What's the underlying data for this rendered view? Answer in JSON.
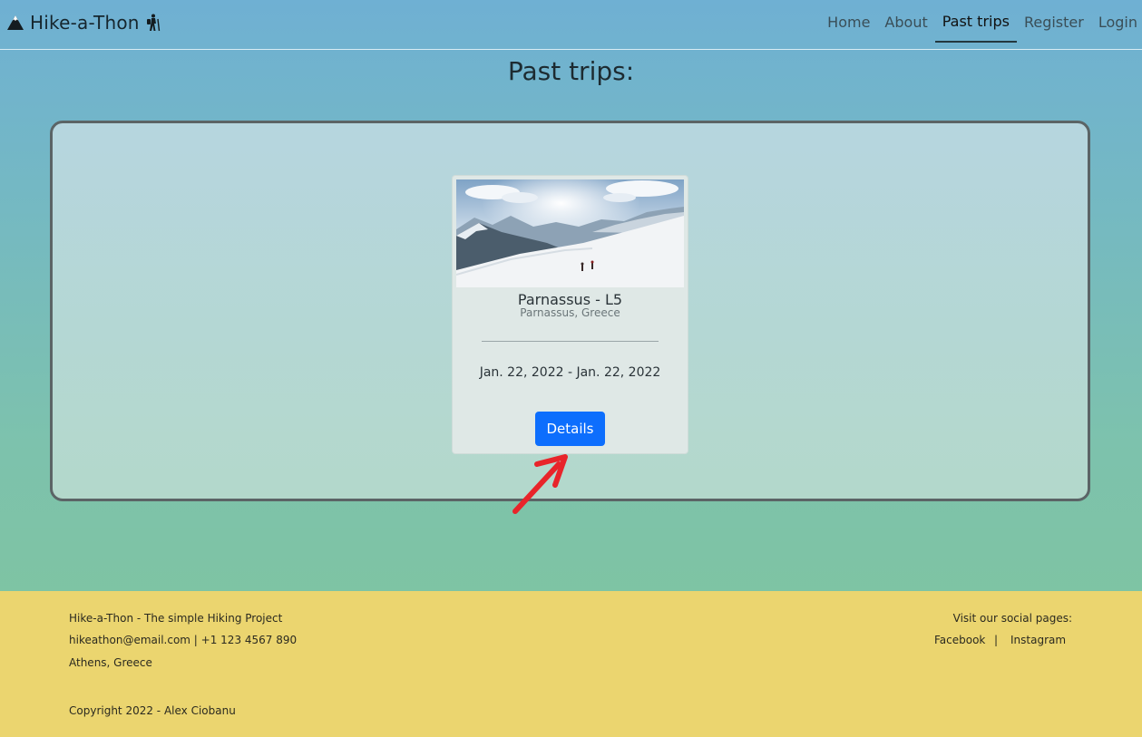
{
  "brand": {
    "name": "Hike-a-Thon"
  },
  "nav": {
    "items": [
      {
        "label": "Home"
      },
      {
        "label": "About"
      },
      {
        "label": "Past trips"
      },
      {
        "label": "Register"
      },
      {
        "label": "Login"
      }
    ],
    "active": "Past trips"
  },
  "page": {
    "title": "Past trips:"
  },
  "trip_card": {
    "title": "Parnassus - L5",
    "location": "Parnassus, Greece",
    "dates": "Jan. 22, 2022 - Jan. 22, 2022",
    "button_label": "Details"
  },
  "footer": {
    "tagline": "Hike-a-Thon - The simple Hiking Project",
    "contact": "hikeathon@email.com | +1 123 4567 890",
    "address": "Athens, Greece",
    "copyright": "Copyright 2022 - Alex Ciobanu",
    "social_heading": "Visit our social pages:",
    "social_links": [
      {
        "label": "Facebook"
      },
      {
        "label": "Instagram"
      }
    ],
    "social_separator": "|"
  },
  "colors": {
    "primary_button": "#0d6efd",
    "footer_bg": "#ebd56f",
    "annotation_arrow": "#e8242a"
  },
  "icons": {
    "brand": "mountain-icon",
    "hiker": "hiker-icon"
  }
}
